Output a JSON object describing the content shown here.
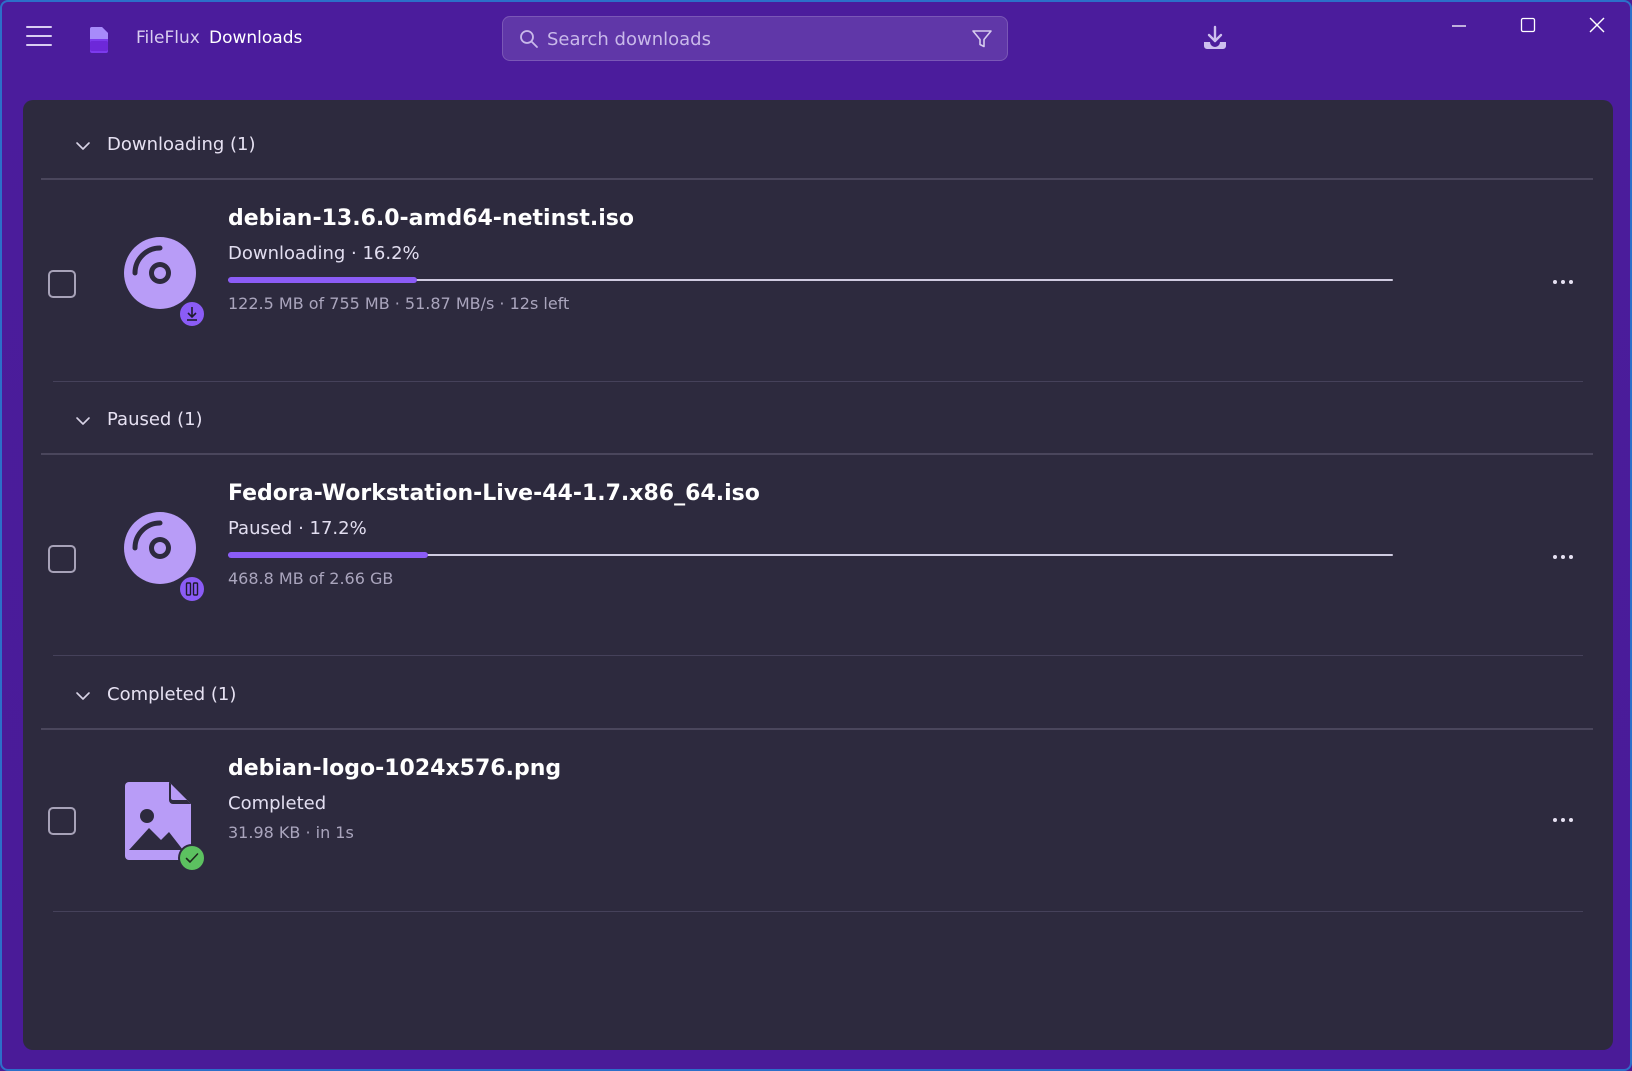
{
  "app": {
    "name": "FileFlux",
    "breadcrumb": "Downloads",
    "search_placeholder": "Search downloads"
  },
  "colors": {
    "accent": "#8b5cf6",
    "icon_fill": "#b89cf7",
    "success": "#5cc160",
    "panel_bg": "#2d2a3e",
    "window_bg": "#4a1d96"
  },
  "groups": [
    {
      "title": "Downloading (1)",
      "items": [
        {
          "name": "debian-13.6.0-amd64-netinst.iso",
          "status": "Downloading · 16.2%",
          "progress": 0.162,
          "details": "122.5 MB of 755 MB · 51.87 MB/s · 12s left",
          "file_icon": "disc-icon",
          "badge_icon": "download-badge-icon"
        }
      ]
    },
    {
      "title": "Paused (1)",
      "items": [
        {
          "name": "Fedora-Workstation-Live-44-1.7.x86_64.iso",
          "status": "Paused · 17.2%",
          "progress": 0.172,
          "details": "468.8 MB of 2.66 GB",
          "file_icon": "disc-icon",
          "badge_icon": "pause-badge-icon"
        }
      ]
    },
    {
      "title": "Completed (1)",
      "items": [
        {
          "name": "debian-logo-1024x576.png",
          "status": "Completed",
          "details": "31.98 KB · in 1s",
          "file_icon": "image-file-icon",
          "badge_icon": "check-badge-icon"
        }
      ]
    }
  ]
}
